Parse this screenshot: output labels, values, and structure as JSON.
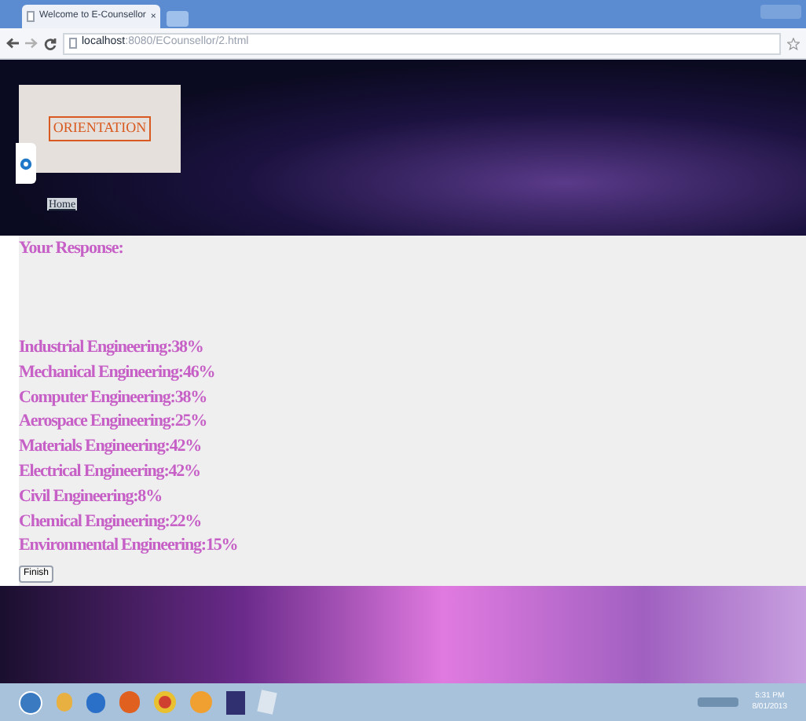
{
  "browser": {
    "tab_title": "Welcome to E-Counsellor",
    "tab_close": "×",
    "url_host": "localhost",
    "url_path": ":8080/ECounsellor/2.html"
  },
  "header": {
    "banner_text": "ORIENTATION",
    "home_link": "Home"
  },
  "response": {
    "heading": "Your Response:",
    "results": [
      {
        "label": "Industrial Engineering:38%"
      },
      {
        "label": "Mechanical Engineering:46%"
      },
      {
        "label": "Computer Engineering:38%"
      },
      {
        "label": "Aerospace Engineering:25%"
      },
      {
        "label": "Materials Engineering:42%"
      },
      {
        "label": "Electrical Engineering:42%"
      },
      {
        "label": "Civil Engineering:8%"
      },
      {
        "label": "Chemical Engineering:22%"
      },
      {
        "label": "Environmental Engineering:15%"
      }
    ],
    "finish_button": "Finish"
  },
  "taskbar": {
    "clock_time": "5:31 PM",
    "clock_date": "8/01/2013"
  }
}
